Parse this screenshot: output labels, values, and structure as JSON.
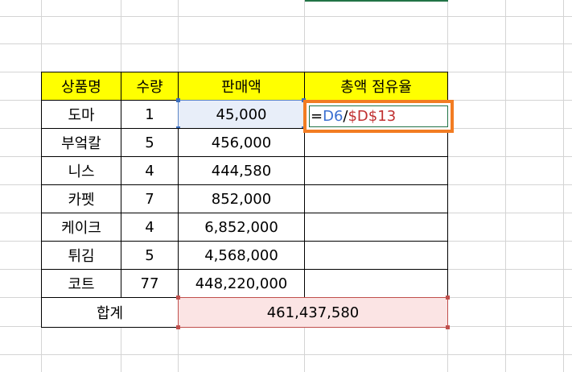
{
  "table": {
    "headers": [
      "상품명",
      "수량",
      "판매액",
      "총액 점유율"
    ],
    "rows": [
      {
        "name": "도마",
        "qty": "1",
        "sales": "45,000"
      },
      {
        "name": "부엌칼",
        "qty": "5",
        "sales": "456,000"
      },
      {
        "name": "니스",
        "qty": "4",
        "sales": "444,580"
      },
      {
        "name": "카펫",
        "qty": "7",
        "sales": "852,000"
      },
      {
        "name": "케이크",
        "qty": "4",
        "sales": "6,852,000"
      },
      {
        "name": "튀김",
        "qty": "5",
        "sales": "4,568,000"
      },
      {
        "name": "코트",
        "qty": "77",
        "sales": "448,220,000"
      }
    ],
    "total_label": "합계",
    "total_value": "461,437,580"
  },
  "formula": {
    "eq": "=",
    "ref1": "D6",
    "op": "/",
    "ref2": "$D$13"
  },
  "colors": {
    "header_fill": "#ffff00",
    "active_outline": "#f27c22",
    "ref1_color": "#3a6fd1",
    "ref2_color": "#c03030",
    "total_fill": "#fbe4e4"
  }
}
